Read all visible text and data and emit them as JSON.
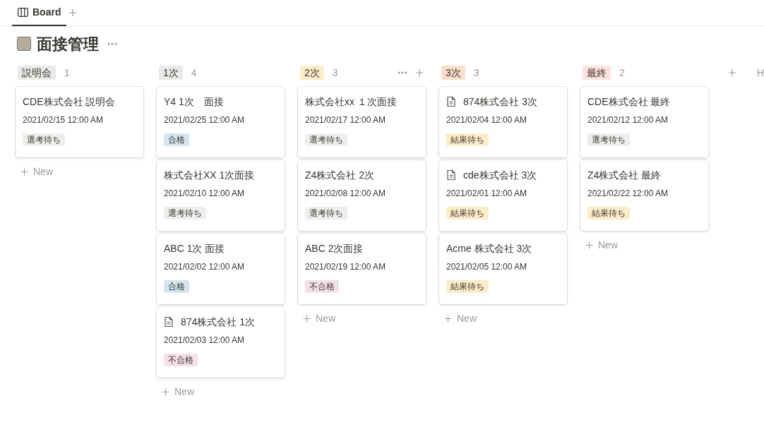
{
  "tabs": [
    {
      "label": "Board",
      "selected": true
    }
  ],
  "title": "面接管理",
  "columns": [
    {
      "name": "説明会",
      "count": "1",
      "color": "#e9e9e7",
      "show_actions": false,
      "cards": [
        {
          "title": "CDE株式会社 説明会",
          "date": "2021/02/15 12:00 AM",
          "tag": {
            "label": "選考待ち",
            "color": "#eeeeed"
          },
          "page_icon": false
        }
      ],
      "new_label": "New"
    },
    {
      "name": "1次",
      "count": "4",
      "color": "#e9e9e7",
      "show_actions": false,
      "cards": [
        {
          "title": "Y4 1次　面接",
          "date": "2021/02/25 12:00 AM",
          "tag": {
            "label": "合格",
            "color": "#d3e5ef"
          },
          "page_icon": false
        },
        {
          "title": "株式会社XX  1次面接",
          "date": "2021/02/10 12:00 AM",
          "tag": {
            "label": "選考待ち",
            "color": "#eeeeed"
          },
          "page_icon": false
        },
        {
          "title": "ABC 1次 面接",
          "date": "2021/02/02 12:00 AM",
          "tag": {
            "label": "合格",
            "color": "#d3e5ef"
          },
          "page_icon": false
        },
        {
          "title": "874株式会社 1次",
          "date": "2021/02/03 12:00 AM",
          "tag": {
            "label": "不合格",
            "color": "#f5e0e9"
          },
          "page_icon": true
        }
      ],
      "new_label": "New"
    },
    {
      "name": "2次",
      "count": "3",
      "color": "#fdecc8",
      "show_actions": true,
      "cards": [
        {
          "title": "株式会社xx １次面接",
          "date": "2021/02/17 12:00 AM",
          "tag": {
            "label": "選考待ち",
            "color": "#eeeeed"
          },
          "page_icon": false
        },
        {
          "title": "Z4株式会社 2次",
          "date": "2021/02/08 12:00 AM",
          "tag": {
            "label": "選考待ち",
            "color": "#eeeeed"
          },
          "page_icon": false
        },
        {
          "title": "ABC 2次面接",
          "date": "2021/02/19 12:00 AM",
          "tag": {
            "label": "不合格",
            "color": "#f5e0e9"
          },
          "page_icon": false
        }
      ],
      "new_label": "New"
    },
    {
      "name": "3次",
      "count": "3",
      "color": "#fadec9",
      "show_actions": false,
      "cards": [
        {
          "title": "874株式会社 3次",
          "date": "2021/02/04 12:00 AM",
          "tag": {
            "label": "結果待ち",
            "color": "#fdecc8"
          },
          "page_icon": true
        },
        {
          "title": "cde株式会社 3次",
          "date": "2021/02/01 12:00 AM",
          "tag": {
            "label": "結果待ち",
            "color": "#fdecc8"
          },
          "page_icon": true
        },
        {
          "title": "Acme 株式会社 3次",
          "date": "2021/02/05 12:00 AM",
          "tag": {
            "label": "結果待ち",
            "color": "#fdecc8"
          },
          "page_icon": false
        }
      ],
      "new_label": "New"
    },
    {
      "name": "最終",
      "count": "2",
      "color": "#ffe2dd",
      "show_actions": false,
      "cards": [
        {
          "title": "CDE株式会社 最終",
          "date": "2021/02/12 12:00 AM",
          "tag": {
            "label": "選考待ち",
            "color": "#eeeeed"
          },
          "page_icon": false
        },
        {
          "title": "Z4株式会社 最終",
          "date": "2021/02/22 12:00 AM",
          "tag": {
            "label": "結果待ち",
            "color": "#fdecc8"
          },
          "page_icon": false
        }
      ],
      "new_label": "New"
    }
  ],
  "hidden_label": "H"
}
